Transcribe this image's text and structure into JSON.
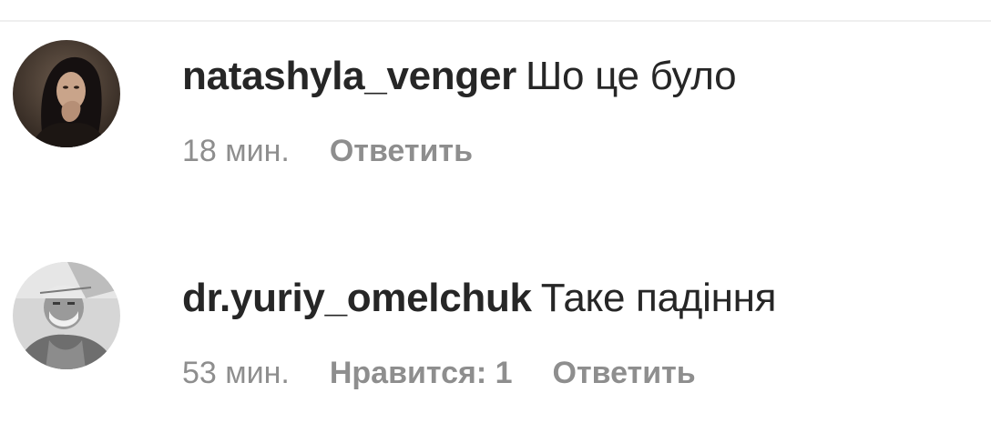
{
  "comments": [
    {
      "username": "natashyla_venger",
      "text": "Шо це було",
      "time": "18 мин.",
      "reply_label": "Ответить",
      "avatar_icon": "user-avatar-dark-hair-icon"
    },
    {
      "username": "dr.yuriy_omelchuk",
      "text": "Таке падіння",
      "time": "53 мин.",
      "likes_label": "Нравится: 1",
      "reply_label": "Ответить",
      "avatar_icon": "user-avatar-masked-doctor-icon"
    }
  ],
  "colors": {
    "username": "#262626",
    "text": "#262626",
    "meta": "#8e8e8e",
    "divider": "#efefef"
  }
}
